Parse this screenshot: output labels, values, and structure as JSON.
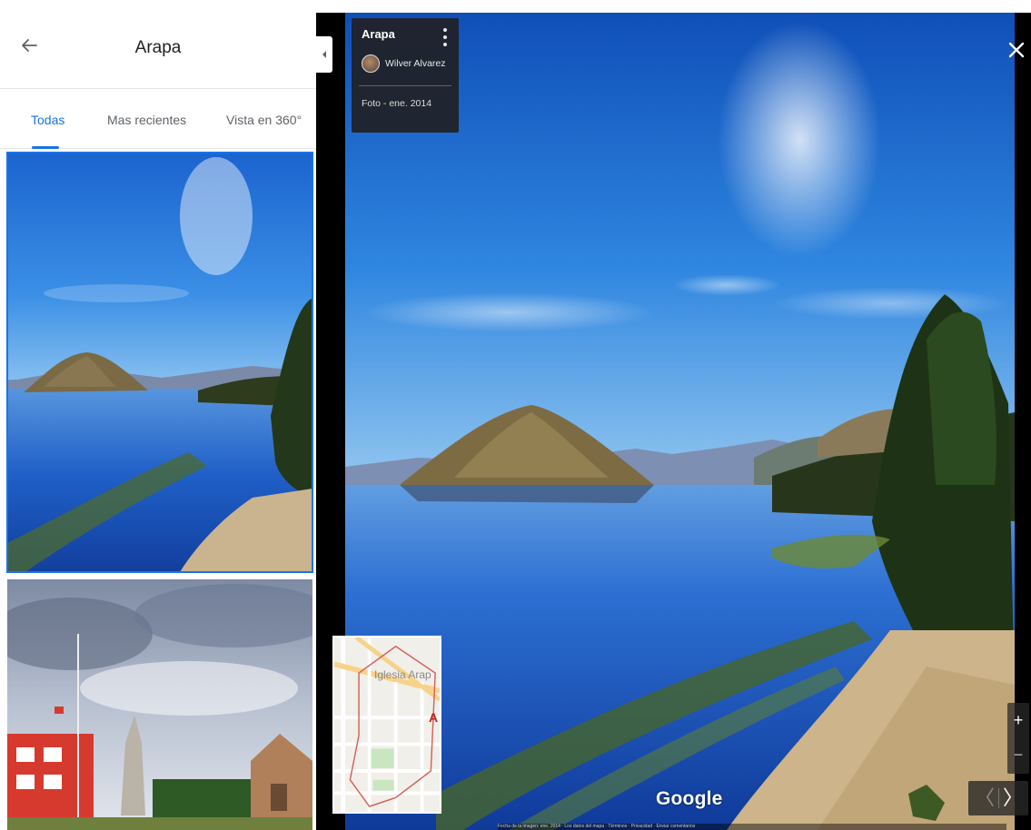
{
  "panel": {
    "title": "Arapa",
    "back_icon": "arrow-left-icon",
    "tabs": [
      {
        "label": "Todas",
        "active": true
      },
      {
        "label": "Mas recientes",
        "active": false
      },
      {
        "label": "Vista en 360°",
        "active": false
      }
    ],
    "accent_color": "#1a73e8"
  },
  "viewer": {
    "info": {
      "title": "Arapa",
      "author": "Wilver Alvarez",
      "date": "Foto - ene. 2014"
    },
    "minimap": {
      "label": "Iglesia Arap",
      "letter": "A"
    },
    "logo": "Google",
    "zoom_in": "+",
    "zoom_out": "−",
    "prev": "〈",
    "next": "〉",
    "attribution": "Fecha de la imagen: ene. 2014  ·  Los datos del mapa  ·  Términos  ·  Privacidad  ·  Enviar comentarios"
  }
}
